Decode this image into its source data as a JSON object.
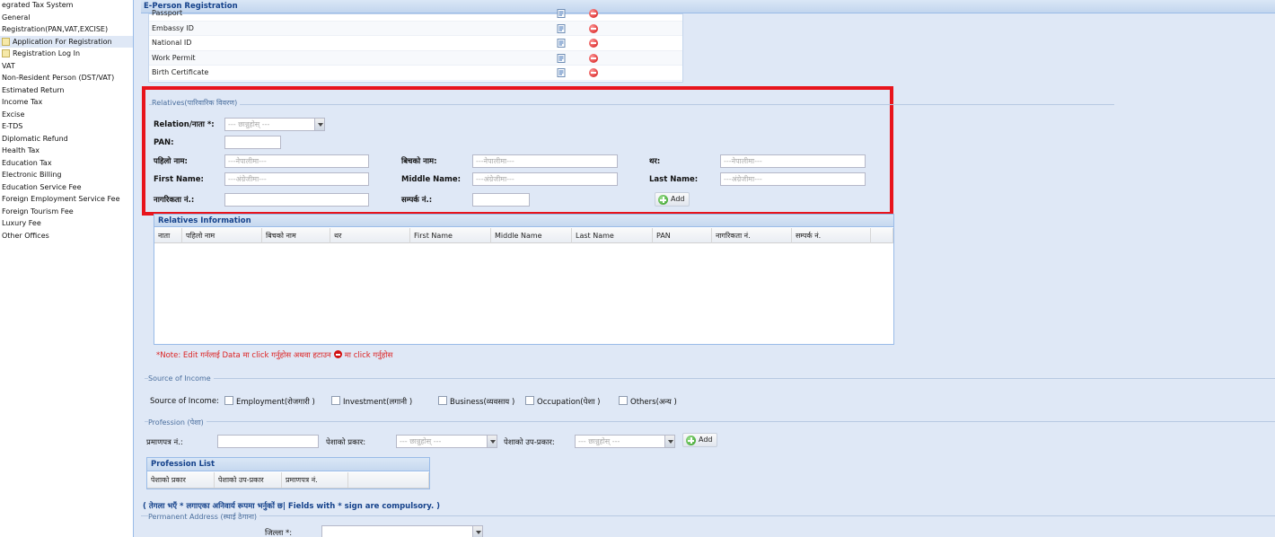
{
  "sidebar": {
    "items": [
      {
        "label": "egrated Tax System",
        "level": 0
      },
      {
        "label": "General",
        "level": 0
      },
      {
        "label": "Registration(PAN,VAT,EXCISE)",
        "level": 0
      },
      {
        "label": "Application For Registration",
        "level": 1,
        "selected": true
      },
      {
        "label": "Registration Log In",
        "level": 1
      },
      {
        "label": "VAT",
        "level": 0
      },
      {
        "label": "Non-Resident Person (DST/VAT)",
        "level": 0
      },
      {
        "label": "Estimated Return",
        "level": 0
      },
      {
        "label": "Income Tax",
        "level": 0
      },
      {
        "label": "Excise",
        "level": 0
      },
      {
        "label": "E-TDS",
        "level": 0
      },
      {
        "label": "Diplomatic Refund",
        "level": 0
      },
      {
        "label": "Health Tax",
        "level": 0
      },
      {
        "label": "Education Tax",
        "level": 0
      },
      {
        "label": "Electronic Billing",
        "level": 0
      },
      {
        "label": "Education Service Fee",
        "level": 0
      },
      {
        "label": "Foreign Employment Service Fee",
        "level": 0
      },
      {
        "label": "Foreign Tourism Fee",
        "level": 0
      },
      {
        "label": "Luxury Fee",
        "level": 0
      },
      {
        "label": "Other Offices",
        "level": 0
      }
    ]
  },
  "panel": {
    "title": "E-Person Registration"
  },
  "documents": {
    "rows": [
      "Passport",
      "Embassy ID",
      "National ID",
      "Work Permit",
      "Birth Certificate"
    ]
  },
  "relatives": {
    "legend": "Relatives(पारिवारिक विवरण)",
    "relation_label": "Relation/नाता *:",
    "relation_placeholder": "--- छान्नुहोस् ---",
    "pan_label": "PAN:",
    "first_name_np_label": "पहिलो नाम:",
    "first_name_np_placeholder": "---नेपालीमा---",
    "middle_name_np_label": "बिचको नाम:",
    "middle_name_np_placeholder": "---नेपालीमा---",
    "last_name_np_label": "थर:",
    "last_name_np_placeholder": "---नेपालीमा---",
    "first_name_label": "First Name:",
    "first_name_placeholder": "---अंग्रेजीमा---",
    "middle_name_label": "Middle Name:",
    "middle_name_placeholder": "---अंग्रेजीमा---",
    "last_name_label": "Last Name:",
    "last_name_placeholder": "---अंग्रेजीमा---",
    "citizenship_label": "नागरिकता नं.:",
    "contact_label": "सम्पर्क नं.:",
    "add_button": "Add"
  },
  "relatives_grid": {
    "title": "Relatives Information",
    "columns": [
      "नाता",
      "पहिलो नाम",
      "बिचको नाम",
      "थर",
      "First Name",
      "Middle Name",
      "Last Name",
      "PAN",
      "नागरिकता नं.",
      "सम्पर्क नं."
    ]
  },
  "note": {
    "before": "*Note: Edit गर्नलाई Data मा click गर्नुहोस अथवा हटाउन",
    "after": "मा click गर्नुहोस"
  },
  "income": {
    "legend": "Source of Income",
    "label": "Source of Income:",
    "options": [
      "Employment(रोजगारी )",
      "Investment(लगानी )",
      "Business(व्यवसाय )",
      "Occupation(पेशा )",
      "Others(अन्य )"
    ]
  },
  "profession": {
    "legend": "Profession (पेशा)",
    "certificate_label": "प्रमाणपत्र नं.:",
    "type_label": "पेशाको प्रकार:",
    "type_placeholder": "--- छान्नुहोस् ---",
    "subtype_label": "पेशाको उप-प्रकार:",
    "subtype_placeholder": "--- छान्नुहोस् ---",
    "add_button": "Add"
  },
  "profession_grid": {
    "title": "Profession List",
    "columns": [
      "पेशाको प्रकार",
      "पेशाको उप-प्रकार",
      "प्रमाणपत्र नं."
    ]
  },
  "compulsory_note": "( तेगला भएँ * लगाएका अनिवार्य रूपमा भर्नुकों छ| Fields with * sign are compulsory. )",
  "permanent_address": {
    "legend": "Permanent Address (स्थाई ठेगाना)",
    "district_label": "जिल्ला *:"
  },
  "colors": {
    "accent": "#15428b",
    "highlight_border": "#e8141c",
    "panel_bg": "#dfe8f6"
  }
}
